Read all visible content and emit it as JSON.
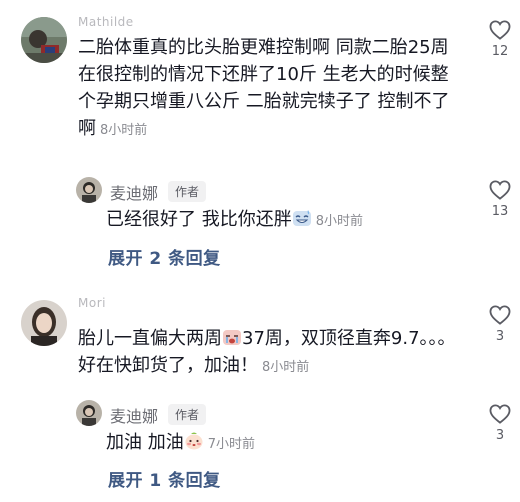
{
  "comments": [
    {
      "username": "Mathilde",
      "text": "二胎体重真的比头胎更难控制啊 同款二胎25周在很控制的情况下还胖了10斤 生老大的时候整个孕期只增重八公斤 二胎就完犊子了 控制不了啊",
      "time": "8小时前",
      "likes": "12",
      "reply": {
        "name": "麦迪娜",
        "badge": "作者",
        "text": "已经很好了 我比你还胖",
        "emoji": "sweat-smile-emoji",
        "time": "8小时前",
        "likes": "13"
      },
      "expand_label": "展开 2 条回复"
    },
    {
      "username": "Mori",
      "text_before": "胎儿一直偏大两周",
      "emoji": "crying-emoji",
      "text_after": "37周，双顶径直奔9.7。。。好在快卸货了，加油！",
      "time": "8小时前",
      "likes": "3",
      "reply": {
        "name": "麦迪娜",
        "badge": "作者",
        "text": "加油 加油",
        "emoji": "blush-emoji",
        "time": "7小时前",
        "likes": "3"
      },
      "expand_label": "展开 1 条回复"
    }
  ],
  "colors": {
    "text": "#161823",
    "muted": "#8a8b91",
    "link": "#3f5983",
    "badge_bg": "#f1f1f2"
  }
}
